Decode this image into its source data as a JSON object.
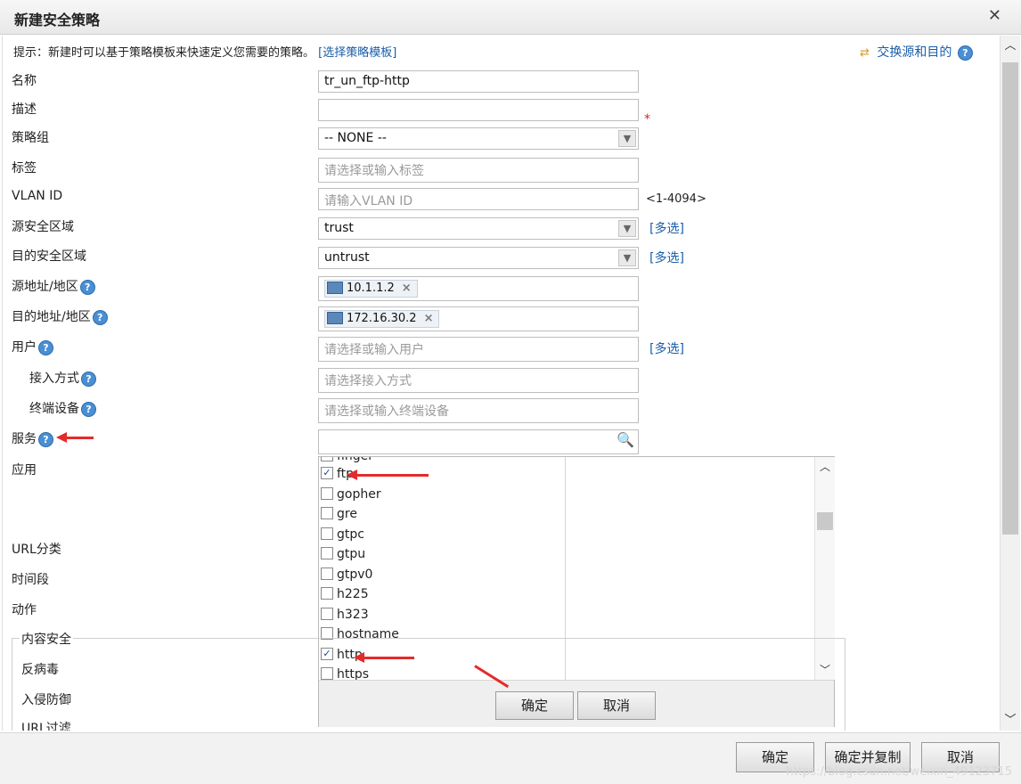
{
  "window": {
    "title": "新建安全策略",
    "close_icon": "close-icon"
  },
  "hint": {
    "text": "提示：新建时可以基于策略模板来快速定义您需要的策略。",
    "link": "[选择策略模板]"
  },
  "swap": {
    "label": "交换源和目的",
    "icon": "swap-arrows-icon"
  },
  "form": {
    "name": {
      "label": "名称",
      "value": "tr_un_ftp-http",
      "required_mark": "*"
    },
    "description": {
      "label": "描述",
      "value": ""
    },
    "policy_group": {
      "label": "策略组",
      "value": "-- NONE --"
    },
    "tag": {
      "label": "标签",
      "placeholder": "请选择或输入标签"
    },
    "vlan": {
      "label": "VLAN ID",
      "placeholder": "请输入VLAN ID",
      "range": "<1-4094>"
    },
    "src_zone": {
      "label": "源安全区域",
      "value": "trust",
      "multi": "[多选]"
    },
    "dst_zone": {
      "label": "目的安全区域",
      "value": "untrust",
      "multi": "[多选]"
    },
    "src_addr": {
      "label": "源地址/地区",
      "tag": "10.1.1.2"
    },
    "dst_addr": {
      "label": "目的地址/地区",
      "tag": "172.16.30.2"
    },
    "user": {
      "label": "用户",
      "placeholder": "请选择或输入用户",
      "multi": "[多选]"
    },
    "access": {
      "label": "接入方式",
      "placeholder": "请选择接入方式"
    },
    "device": {
      "label": "终端设备",
      "placeholder": "请选择或输入终端设备"
    },
    "service": {
      "label": "服务"
    },
    "application": {
      "label": "应用"
    },
    "url_category": {
      "label": "URL分类"
    },
    "time_range": {
      "label": "时间段"
    },
    "action": {
      "label": "动作"
    },
    "content_security": {
      "legend": "内容安全",
      "antivirus": "反病毒",
      "ips": "入侵防御",
      "url_filter": "URL过滤"
    }
  },
  "service_dropdown": {
    "items": [
      {
        "label": "finger",
        "checked": false
      },
      {
        "label": "ftp",
        "checked": true
      },
      {
        "label": "gopher",
        "checked": false
      },
      {
        "label": "gre",
        "checked": false
      },
      {
        "label": "gtpc",
        "checked": false
      },
      {
        "label": "gtpu",
        "checked": false
      },
      {
        "label": "gtpv0",
        "checked": false
      },
      {
        "label": "h225",
        "checked": false
      },
      {
        "label": "h323",
        "checked": false
      },
      {
        "label": "hostname",
        "checked": false
      },
      {
        "label": "http",
        "checked": true
      },
      {
        "label": "https",
        "checked": false
      }
    ],
    "ok": "确定",
    "cancel": "取消"
  },
  "footer": {
    "ok": "确定",
    "ok_copy": "确定并复制",
    "cancel": "取消",
    "watermark": "https://blog.csdn.net/weixin_49123715"
  }
}
